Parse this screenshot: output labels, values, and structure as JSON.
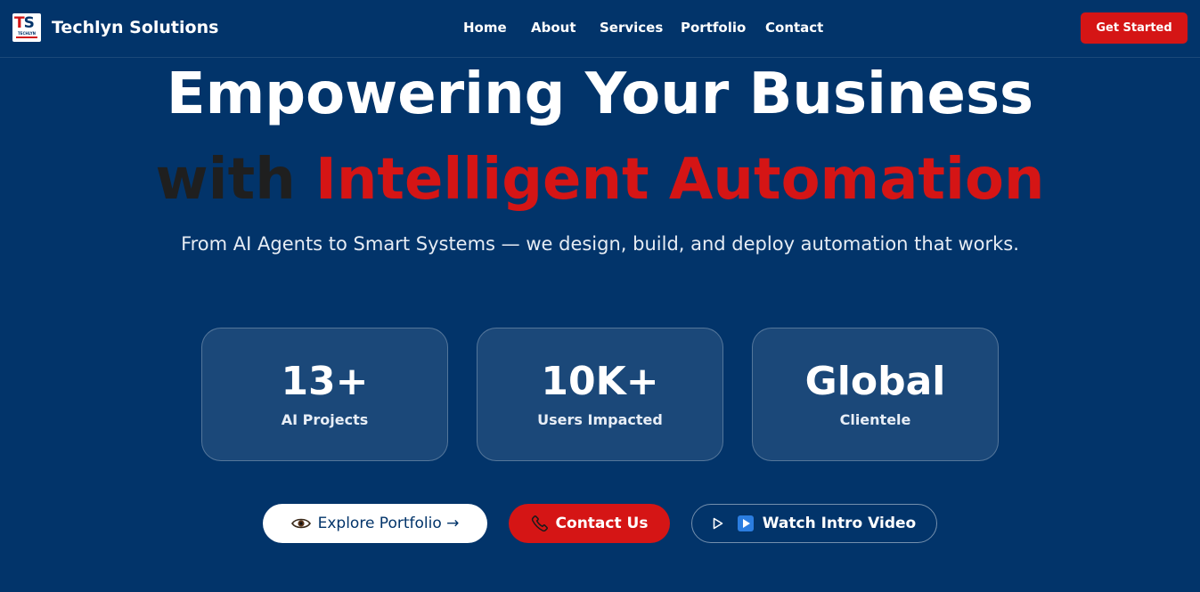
{
  "brand": {
    "name": "Techlyn Solutions",
    "logo_text": "TS",
    "logo_subtext": "TECHLYN"
  },
  "nav": {
    "items": [
      {
        "label": "Home"
      },
      {
        "label": "About"
      },
      {
        "label": "Services"
      },
      {
        "label": "Portfolio"
      },
      {
        "label": "Contact"
      }
    ],
    "cta_label": "Get Started"
  },
  "hero": {
    "line1": "Empowering Your Business",
    "line2_prefix": "with",
    "line2_highlight": "Intelligent Automation",
    "subtitle": "From AI Agents to Smart Systems — we design, build, and deploy automation that works."
  },
  "stats": [
    {
      "value": "13+",
      "label": "AI Projects"
    },
    {
      "value": "10K+",
      "label": "Users Impacted"
    },
    {
      "value": "Global",
      "label": "Clientele"
    }
  ],
  "actions": {
    "explore": {
      "icon": "eye-icon",
      "label": "Explore Portfolio →"
    },
    "contact": {
      "icon": "phone-icon",
      "label": "Contact Us"
    },
    "watch": {
      "icon": "play-icon",
      "label": "Watch Intro Video"
    }
  },
  "colors": {
    "background": "#02346a",
    "accent_red": "#d51515",
    "headline_dark": "#1f1f1f",
    "card_fill": "rgba(255,255,255,0.10)"
  }
}
